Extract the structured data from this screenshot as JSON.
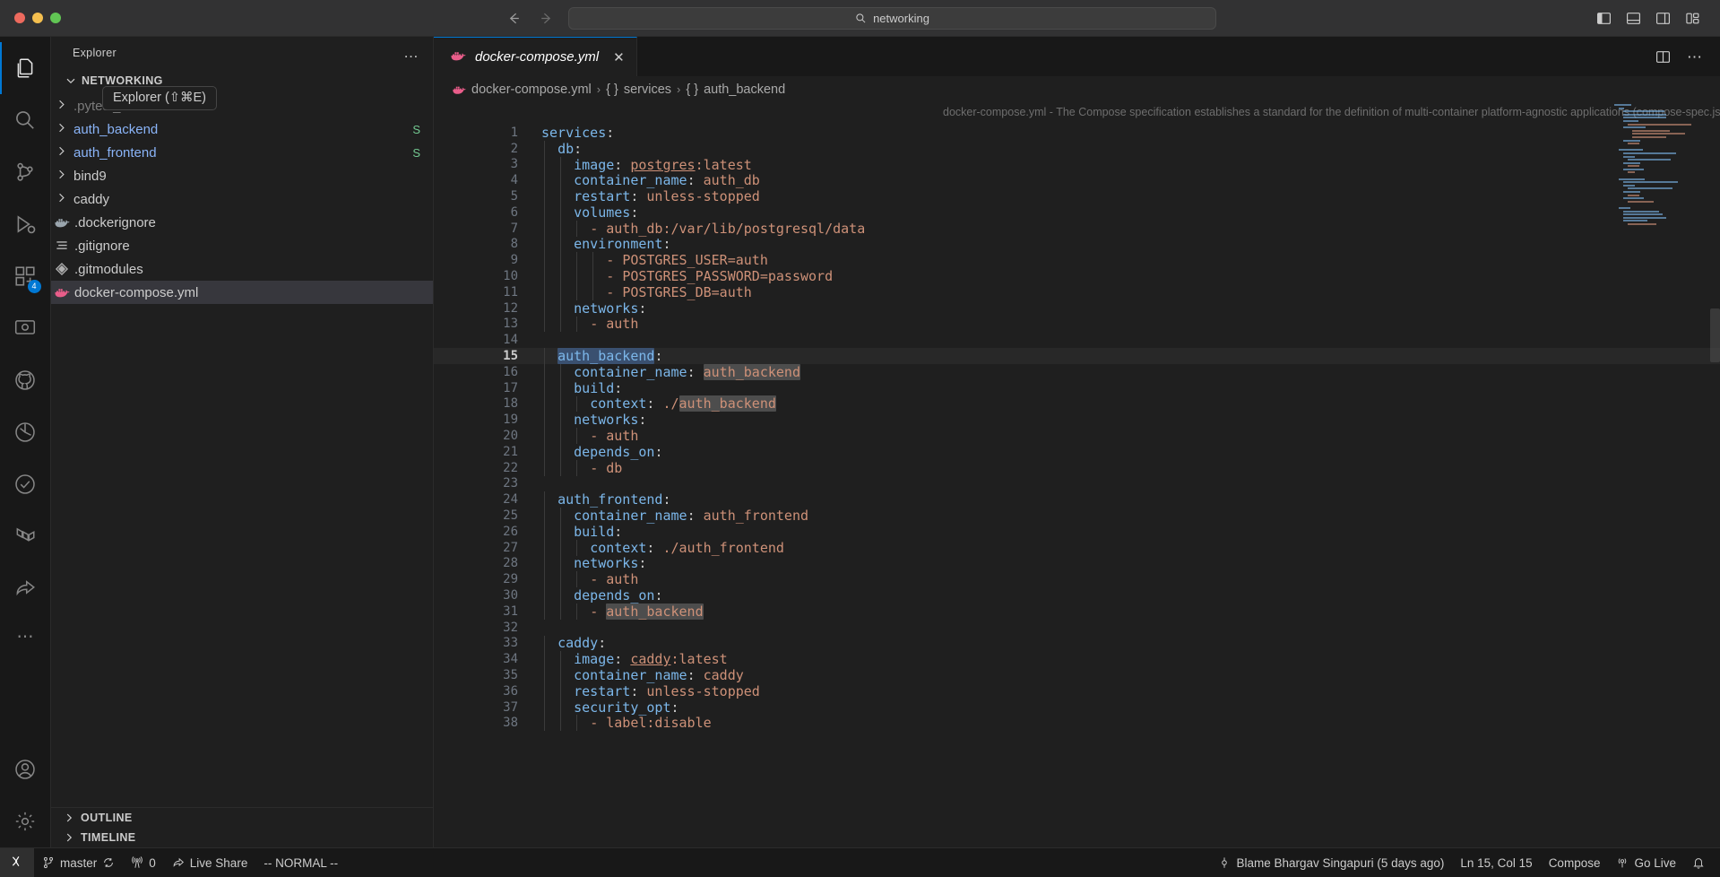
{
  "titlebar": {
    "traffic": [
      "close",
      "minimize",
      "maximize"
    ],
    "back_label": "←",
    "forward_label": "→",
    "search_value": "networking",
    "search_icon": "search-icon",
    "layout_icons": [
      "toggle-primary-sidebar-icon",
      "toggle-panel-icon",
      "toggle-secondary-sidebar-icon",
      "customize-layout-icon"
    ]
  },
  "activitybar": {
    "items": [
      {
        "name": "explorer",
        "icon": "files-icon",
        "badge": ""
      },
      {
        "name": "search",
        "icon": "search-icon",
        "badge": ""
      },
      {
        "name": "source-control",
        "icon": "source-control-icon",
        "badge": ""
      },
      {
        "name": "run-and-debug",
        "icon": "debug-icon",
        "badge": ""
      },
      {
        "name": "extensions",
        "icon": "extensions-icon",
        "badge": "4"
      },
      {
        "name": "remote-explorer",
        "icon": "remote-explorer-icon",
        "badge": ""
      },
      {
        "name": "github",
        "icon": "github-icon",
        "badge": ""
      },
      {
        "name": "gitlens",
        "icon": "gitlens-icon",
        "badge": ""
      },
      {
        "name": "testing",
        "icon": "testing-beaker-icon",
        "badge": ""
      },
      {
        "name": "terraform",
        "icon": "terraform-icon",
        "badge": ""
      },
      {
        "name": "live-share",
        "icon": "live-share-icon",
        "badge": ""
      },
      {
        "name": "more-views",
        "icon": "ellipsis-icon",
        "badge": ""
      }
    ],
    "bottom": [
      {
        "name": "accounts",
        "icon": "account-icon"
      },
      {
        "name": "manage",
        "icon": "gear-icon"
      }
    ]
  },
  "sidebar": {
    "header_title": "Explorer",
    "more_actions": "…",
    "tooltip": "Explorer (⇧⌘E)",
    "section_label": "NETWORKING",
    "tree": [
      {
        "label": ".pytest_cache",
        "type": "folder",
        "icon": "chevron-right-icon",
        "dim": true,
        "link": false,
        "badge": ""
      },
      {
        "label": "auth_backend",
        "type": "folder",
        "icon": "chevron-right-icon",
        "dim": false,
        "link": true,
        "badge": "S"
      },
      {
        "label": "auth_frontend",
        "type": "folder",
        "icon": "chevron-right-icon",
        "dim": false,
        "link": true,
        "badge": "S"
      },
      {
        "label": "bind9",
        "type": "folder",
        "icon": "chevron-right-icon",
        "dim": false,
        "link": false,
        "badge": ""
      },
      {
        "label": "caddy",
        "type": "folder",
        "icon": "chevron-right-icon",
        "dim": false,
        "link": false,
        "badge": ""
      },
      {
        "label": ".dockerignore",
        "type": "file",
        "icon": "docker-icon",
        "dim": false,
        "link": false,
        "badge": ""
      },
      {
        "label": ".gitignore",
        "type": "file",
        "icon": "gitignore-icon",
        "dim": false,
        "link": false,
        "badge": ""
      },
      {
        "label": ".gitmodules",
        "type": "file",
        "icon": "gitmodules-icon",
        "dim": false,
        "link": false,
        "badge": ""
      },
      {
        "label": "docker-compose.yml",
        "type": "file",
        "icon": "docker-icon",
        "dim": false,
        "link": false,
        "badge": "",
        "selected": true
      }
    ],
    "bottom_panels": [
      {
        "label": "OUTLINE"
      },
      {
        "label": "TIMELINE"
      }
    ]
  },
  "editor": {
    "tab": {
      "label": "docker-compose.yml",
      "icon": "docker-icon",
      "close_label": "✕",
      "preview": true
    },
    "tab_actions": [
      "split-editor-icon",
      "more-actions-icon"
    ],
    "breadcrumb": [
      {
        "label": "docker-compose.yml",
        "icon": "docker-icon"
      },
      {
        "label": "services",
        "icon": "braces-icon"
      },
      {
        "label": "auth_backend",
        "icon": "braces-icon"
      }
    ],
    "breadcrumb_separator": "›",
    "hint": "docker-compose.yml - The Compose specification establishes a standard for the definition of multi-container platform-agnostic applications (compose-spec.json)",
    "active_line": 15,
    "lines": [
      {
        "n": 1,
        "indent": 0,
        "tokens": [
          {
            "t": "services",
            "c": "k"
          },
          {
            "t": ":",
            "c": "p"
          }
        ]
      },
      {
        "n": 2,
        "indent": 1,
        "tokens": [
          {
            "t": "db",
            "c": "k"
          },
          {
            "t": ":",
            "c": "p"
          }
        ]
      },
      {
        "n": 3,
        "indent": 2,
        "tokens": [
          {
            "t": "image",
            "c": "k"
          },
          {
            "t": ": ",
            "c": "p"
          },
          {
            "t": "postgres",
            "c": "v u"
          },
          {
            "t": ":latest",
            "c": "v"
          }
        ]
      },
      {
        "n": 4,
        "indent": 2,
        "tokens": [
          {
            "t": "container_name",
            "c": "k"
          },
          {
            "t": ": ",
            "c": "p"
          },
          {
            "t": "auth_db",
            "c": "v"
          }
        ]
      },
      {
        "n": 5,
        "indent": 2,
        "tokens": [
          {
            "t": "restart",
            "c": "k"
          },
          {
            "t": ": ",
            "c": "p"
          },
          {
            "t": "unless-stopped",
            "c": "v"
          }
        ]
      },
      {
        "n": 6,
        "indent": 2,
        "tokens": [
          {
            "t": "volumes",
            "c": "k"
          },
          {
            "t": ":",
            "c": "p"
          }
        ]
      },
      {
        "n": 7,
        "indent": 3,
        "tokens": [
          {
            "t": "- ",
            "c": "v"
          },
          {
            "t": "auth_db:/var/lib/postgresql/data",
            "c": "v"
          }
        ]
      },
      {
        "n": 8,
        "indent": 2,
        "tokens": [
          {
            "t": "environment",
            "c": "k"
          },
          {
            "t": ":",
            "c": "p"
          }
        ]
      },
      {
        "n": 9,
        "indent": 4,
        "tokens": [
          {
            "t": "- ",
            "c": "v"
          },
          {
            "t": "POSTGRES_USER=auth",
            "c": "v"
          }
        ]
      },
      {
        "n": 10,
        "indent": 4,
        "tokens": [
          {
            "t": "- ",
            "c": "v"
          },
          {
            "t": "POSTGRES_PASSWORD=password",
            "c": "v"
          }
        ]
      },
      {
        "n": 11,
        "indent": 4,
        "tokens": [
          {
            "t": "- ",
            "c": "v"
          },
          {
            "t": "POSTGRES_DB=auth",
            "c": "v"
          }
        ]
      },
      {
        "n": 12,
        "indent": 2,
        "tokens": [
          {
            "t": "networks",
            "c": "k"
          },
          {
            "t": ":",
            "c": "p"
          }
        ]
      },
      {
        "n": 13,
        "indent": 3,
        "tokens": [
          {
            "t": "- ",
            "c": "v"
          },
          {
            "t": "auth",
            "c": "v"
          }
        ]
      },
      {
        "n": 14,
        "indent": 0,
        "tokens": []
      },
      {
        "n": 15,
        "indent": 1,
        "tokens": [
          {
            "t": "auth_backend",
            "c": "k sel"
          },
          {
            "t": ":",
            "c": "p"
          }
        ]
      },
      {
        "n": 16,
        "indent": 2,
        "tokens": [
          {
            "t": "container_name",
            "c": "k"
          },
          {
            "t": ": ",
            "c": "p"
          },
          {
            "t": "auth_backend",
            "c": "v hl"
          }
        ]
      },
      {
        "n": 17,
        "indent": 2,
        "tokens": [
          {
            "t": "build",
            "c": "k"
          },
          {
            "t": ":",
            "c": "p"
          }
        ]
      },
      {
        "n": 18,
        "indent": 3,
        "tokens": [
          {
            "t": "context",
            "c": "k"
          },
          {
            "t": ": ",
            "c": "p"
          },
          {
            "t": "./",
            "c": "v"
          },
          {
            "t": "auth_backend",
            "c": "v hl"
          }
        ]
      },
      {
        "n": 19,
        "indent": 2,
        "tokens": [
          {
            "t": "networks",
            "c": "k"
          },
          {
            "t": ":",
            "c": "p"
          }
        ]
      },
      {
        "n": 20,
        "indent": 3,
        "tokens": [
          {
            "t": "- ",
            "c": "v"
          },
          {
            "t": "auth",
            "c": "v"
          }
        ]
      },
      {
        "n": 21,
        "indent": 2,
        "tokens": [
          {
            "t": "depends_on",
            "c": "k"
          },
          {
            "t": ":",
            "c": "p"
          }
        ]
      },
      {
        "n": 22,
        "indent": 3,
        "tokens": [
          {
            "t": "- ",
            "c": "v"
          },
          {
            "t": "db",
            "c": "v"
          }
        ]
      },
      {
        "n": 23,
        "indent": 0,
        "tokens": []
      },
      {
        "n": 24,
        "indent": 1,
        "tokens": [
          {
            "t": "auth_frontend",
            "c": "k"
          },
          {
            "t": ":",
            "c": "p"
          }
        ]
      },
      {
        "n": 25,
        "indent": 2,
        "tokens": [
          {
            "t": "container_name",
            "c": "k"
          },
          {
            "t": ": ",
            "c": "p"
          },
          {
            "t": "auth_frontend",
            "c": "v"
          }
        ]
      },
      {
        "n": 26,
        "indent": 2,
        "tokens": [
          {
            "t": "build",
            "c": "k"
          },
          {
            "t": ":",
            "c": "p"
          }
        ]
      },
      {
        "n": 27,
        "indent": 3,
        "tokens": [
          {
            "t": "context",
            "c": "k"
          },
          {
            "t": ": ",
            "c": "p"
          },
          {
            "t": "./auth_frontend",
            "c": "v"
          }
        ]
      },
      {
        "n": 28,
        "indent": 2,
        "tokens": [
          {
            "t": "networks",
            "c": "k"
          },
          {
            "t": ":",
            "c": "p"
          }
        ]
      },
      {
        "n": 29,
        "indent": 3,
        "tokens": [
          {
            "t": "- ",
            "c": "v"
          },
          {
            "t": "auth",
            "c": "v"
          }
        ]
      },
      {
        "n": 30,
        "indent": 2,
        "tokens": [
          {
            "t": "depends_on",
            "c": "k"
          },
          {
            "t": ":",
            "c": "p"
          }
        ]
      },
      {
        "n": 31,
        "indent": 3,
        "tokens": [
          {
            "t": "- ",
            "c": "v"
          },
          {
            "t": "auth_backend",
            "c": "v hl"
          }
        ]
      },
      {
        "n": 32,
        "indent": 0,
        "tokens": []
      },
      {
        "n": 33,
        "indent": 1,
        "tokens": [
          {
            "t": "caddy",
            "c": "k"
          },
          {
            "t": ":",
            "c": "p"
          }
        ]
      },
      {
        "n": 34,
        "indent": 2,
        "tokens": [
          {
            "t": "image",
            "c": "k"
          },
          {
            "t": ": ",
            "c": "p"
          },
          {
            "t": "caddy",
            "c": "v u"
          },
          {
            "t": ":latest",
            "c": "v"
          }
        ]
      },
      {
        "n": 35,
        "indent": 2,
        "tokens": [
          {
            "t": "container_name",
            "c": "k"
          },
          {
            "t": ": ",
            "c": "p"
          },
          {
            "t": "caddy",
            "c": "v"
          }
        ]
      },
      {
        "n": 36,
        "indent": 2,
        "tokens": [
          {
            "t": "restart",
            "c": "k"
          },
          {
            "t": ": ",
            "c": "p"
          },
          {
            "t": "unless-stopped",
            "c": "v"
          }
        ]
      },
      {
        "n": 37,
        "indent": 2,
        "tokens": [
          {
            "t": "security_opt",
            "c": "k"
          },
          {
            "t": ":",
            "c": "p"
          }
        ]
      },
      {
        "n": 38,
        "indent": 3,
        "tokens": [
          {
            "t": "- ",
            "c": "v"
          },
          {
            "t": "label:disable",
            "c": "v"
          }
        ]
      }
    ]
  },
  "statusbar": {
    "remote_icon": "remote-window-icon",
    "left": [
      {
        "name": "git-branch",
        "icon": "git-branch-icon",
        "label": "master",
        "trailing_icon": "sync-icon"
      },
      {
        "name": "ports",
        "icon": "radio-tower-icon",
        "label": "0"
      },
      {
        "name": "live-share",
        "icon": "live-share-icon",
        "label": "Live Share"
      },
      {
        "name": "vim-mode",
        "icon": "",
        "label": "-- NORMAL --"
      }
    ],
    "right": [
      {
        "name": "git-blame",
        "icon": "git-commit-icon",
        "label": "Blame Bhargav Singapuri (5 days ago)"
      },
      {
        "name": "cursor-position",
        "icon": "",
        "label": "Ln 15, Col 15"
      },
      {
        "name": "language-mode",
        "icon": "",
        "label": "Compose"
      },
      {
        "name": "go-live",
        "icon": "broadcast-icon",
        "label": "Go Live"
      },
      {
        "name": "notifications",
        "icon": "bell-icon",
        "label": ""
      }
    ]
  },
  "colors": {
    "accent": "#0078d4",
    "key": "#7cb7ea",
    "value": "#ce9178",
    "badge_s": "#73c991",
    "docker_pink": "#e95d8a"
  }
}
